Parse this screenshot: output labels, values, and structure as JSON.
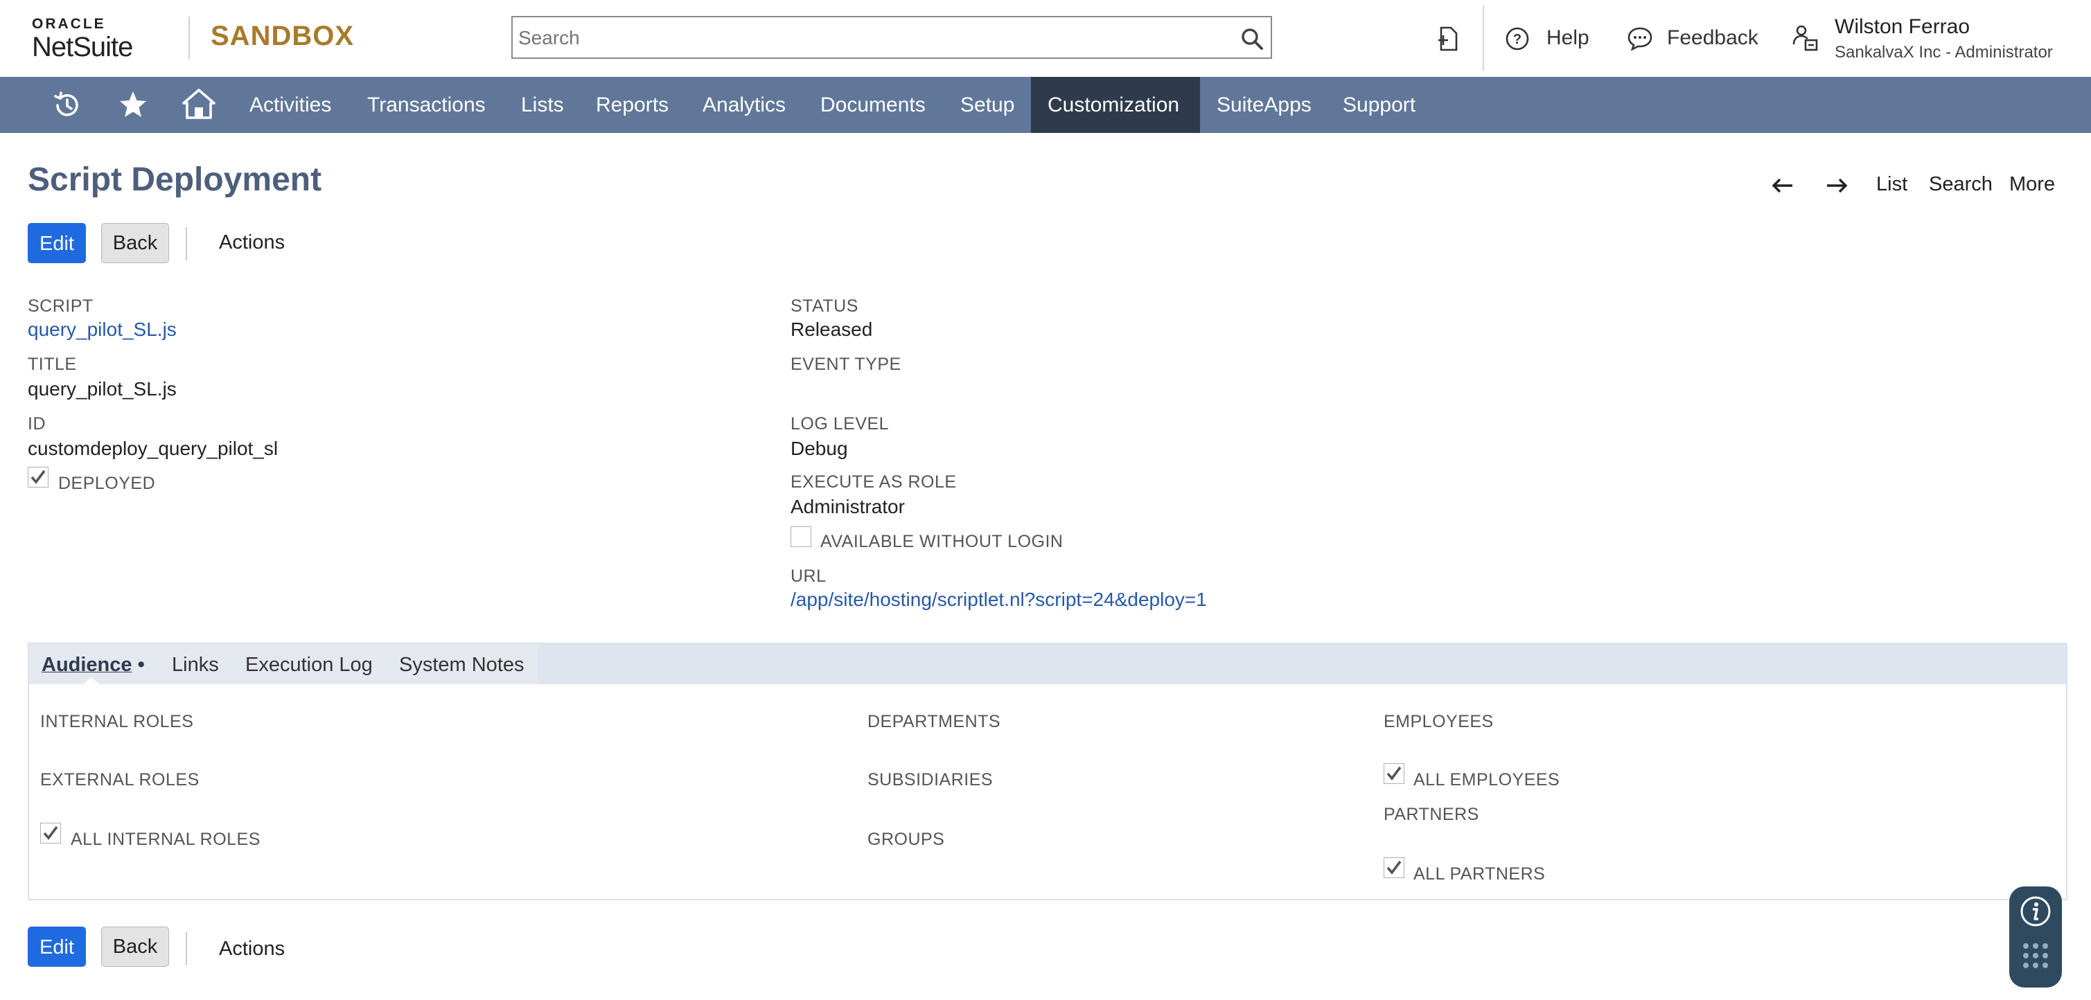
{
  "header": {
    "logo_oracle": "ORACLE",
    "logo_netsuite": "NetSuite",
    "environment": "SANDBOX",
    "search_placeholder": "Search",
    "help_label": "Help",
    "feedback_label": "Feedback",
    "user_name": "Wilston Ferrao",
    "user_role": "SankalvaX Inc - Administrator"
  },
  "nav": {
    "items": [
      "Activities",
      "Transactions",
      "Lists",
      "Reports",
      "Analytics",
      "Documents",
      "Setup",
      "Customization",
      "SuiteApps",
      "Support"
    ],
    "active": "Customization"
  },
  "page": {
    "title": "Script Deployment",
    "pager_list": "List",
    "pager_search": "Search",
    "pager_more": "More"
  },
  "buttons": {
    "edit": "Edit",
    "back": "Back",
    "actions": "Actions"
  },
  "fields": {
    "script_label": "SCRIPT",
    "script_value": "query_pilot_SL.js",
    "title_label": "TITLE",
    "title_value": "query_pilot_SL.js",
    "id_label": "ID",
    "id_value": "customdeploy_query_pilot_sl",
    "deployed_label": "DEPLOYED",
    "deployed_checked": true,
    "status_label": "STATUS",
    "status_value": "Released",
    "event_type_label": "EVENT TYPE",
    "log_level_label": "LOG LEVEL",
    "log_level_value": "Debug",
    "execute_as_role_label": "EXECUTE AS ROLE",
    "execute_as_role_value": "Administrator",
    "available_without_login_label": "AVAILABLE WITHOUT LOGIN",
    "available_without_login_checked": false,
    "url_label": "URL",
    "url_value": "/app/site/hosting/scriptlet.nl?script=24&deploy=1"
  },
  "tabs": {
    "items": [
      {
        "label": "Audience",
        "active": true
      },
      {
        "label": "Links",
        "active": false
      },
      {
        "label": "Execution Log",
        "active": false
      },
      {
        "label": "System Notes",
        "active": false
      }
    ],
    "active_marker": "•"
  },
  "audience": {
    "internal_roles": "INTERNAL ROLES",
    "external_roles": "EXTERNAL ROLES",
    "all_internal_roles": "ALL INTERNAL ROLES",
    "departments": "DEPARTMENTS",
    "subsidiaries": "SUBSIDIARIES",
    "groups": "GROUPS",
    "employees": "EMPLOYEES",
    "all_employees": "ALL EMPLOYEES",
    "partners": "PARTNERS",
    "all_partners": "ALL PARTNERS"
  },
  "colors": {
    "nav_bg": "#607799",
    "nav_active_bg": "#2f3b4d",
    "primary_button": "#1f6ae0",
    "title_color": "#4d5f7c",
    "link_color": "#2559a8",
    "sandbox_color": "#a87a2a"
  }
}
